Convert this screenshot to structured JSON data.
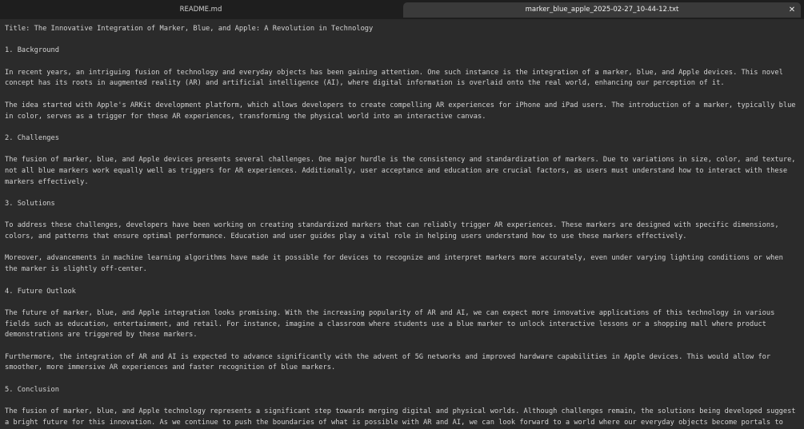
{
  "tabs": [
    {
      "label": "README.md",
      "active": false
    },
    {
      "label": "marker_blue_apple_2025-02-27_10-44-12.txt",
      "active": true
    }
  ],
  "close_glyph": "✕",
  "document": {
    "lines": [
      "Title: The Innovative Integration of Marker, Blue, and Apple: A Revolution in Technology",
      "",
      "1. Background",
      "",
      "In recent years, an intriguing fusion of technology and everyday objects has been gaining attention. One such instance is the integration of a marker, blue, and Apple devices. This novel",
      "concept has its roots in augmented reality (AR) and artificial intelligence (AI), where digital information is overlaid onto the real world, enhancing our perception of it.",
      "",
      "The idea started with Apple's ARKit development platform, which allows developers to create compelling AR experiences for iPhone and iPad users. The introduction of a marker, typically blue",
      "in color, serves as a trigger for these AR experiences, transforming the physical world into an interactive canvas.",
      "",
      "2. Challenges",
      "",
      "The fusion of marker, blue, and Apple devices presents several challenges. One major hurdle is the consistency and standardization of markers. Due to variations in size, color, and texture,",
      "not all blue markers work equally well as triggers for AR experiences. Additionally, user acceptance and education are crucial factors, as users must understand how to interact with these",
      "markers effectively.",
      "",
      "3. Solutions",
      "",
      "To address these challenges, developers have been working on creating standardized markers that can reliably trigger AR experiences. These markers are designed with specific dimensions,",
      "colors, and patterns that ensure optimal performance. Education and user guides play a vital role in helping users understand how to use these markers effectively.",
      "",
      "Moreover, advancements in machine learning algorithms have made it possible for devices to recognize and interpret markers more accurately, even under varying lighting conditions or when",
      "the marker is slightly off-center.",
      "",
      "4. Future Outlook",
      "",
      "The future of marker, blue, and Apple integration looks promising. With the increasing popularity of AR and AI, we can expect more innovative applications of this technology in various",
      "fields such as education, entertainment, and retail. For instance, imagine a classroom where students use a blue marker to unlock interactive lessons or a shopping mall where product",
      "demonstrations are triggered by these markers.",
      "",
      "Furthermore, the integration of AR and AI is expected to advance significantly with the advent of 5G networks and improved hardware capabilities in Apple devices. This would allow for",
      "smoother, more immersive AR experiences and faster recognition of blue markers.",
      "",
      "5. Conclusion",
      "",
      "The fusion of marker, blue, and Apple technology represents a significant step towards merging digital and physical worlds. Although challenges remain, the solutions being developed suggest",
      "a bright future for this innovation. As we continue to push the boundaries of what is possible with AR and AI, we can look forward to a world where our everyday objects become portals to"
    ]
  }
}
